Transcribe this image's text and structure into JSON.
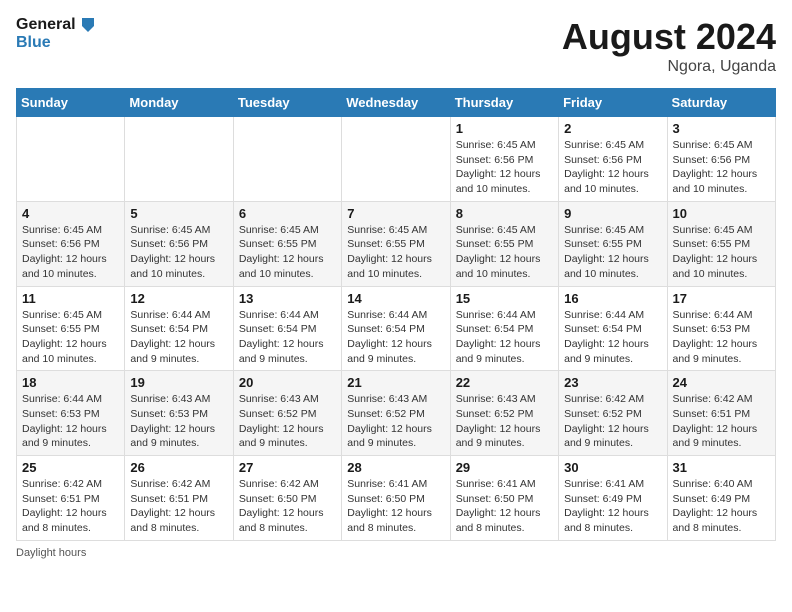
{
  "logo": {
    "line1": "General",
    "line2": "Blue"
  },
  "title": "August 2024",
  "location": "Ngora, Uganda",
  "days_of_week": [
    "Sunday",
    "Monday",
    "Tuesday",
    "Wednesday",
    "Thursday",
    "Friday",
    "Saturday"
  ],
  "footer": {
    "label": "Daylight hours"
  },
  "weeks": [
    [
      {
        "day": "",
        "sunrise": "",
        "sunset": "",
        "daylight": ""
      },
      {
        "day": "",
        "sunrise": "",
        "sunset": "",
        "daylight": ""
      },
      {
        "day": "",
        "sunrise": "",
        "sunset": "",
        "daylight": ""
      },
      {
        "day": "",
        "sunrise": "",
        "sunset": "",
        "daylight": ""
      },
      {
        "day": "1",
        "sunrise": "Sunrise: 6:45 AM",
        "sunset": "Sunset: 6:56 PM",
        "daylight": "Daylight: 12 hours and 10 minutes."
      },
      {
        "day": "2",
        "sunrise": "Sunrise: 6:45 AM",
        "sunset": "Sunset: 6:56 PM",
        "daylight": "Daylight: 12 hours and 10 minutes."
      },
      {
        "day": "3",
        "sunrise": "Sunrise: 6:45 AM",
        "sunset": "Sunset: 6:56 PM",
        "daylight": "Daylight: 12 hours and 10 minutes."
      }
    ],
    [
      {
        "day": "4",
        "sunrise": "Sunrise: 6:45 AM",
        "sunset": "Sunset: 6:56 PM",
        "daylight": "Daylight: 12 hours and 10 minutes."
      },
      {
        "day": "5",
        "sunrise": "Sunrise: 6:45 AM",
        "sunset": "Sunset: 6:56 PM",
        "daylight": "Daylight: 12 hours and 10 minutes."
      },
      {
        "day": "6",
        "sunrise": "Sunrise: 6:45 AM",
        "sunset": "Sunset: 6:55 PM",
        "daylight": "Daylight: 12 hours and 10 minutes."
      },
      {
        "day": "7",
        "sunrise": "Sunrise: 6:45 AM",
        "sunset": "Sunset: 6:55 PM",
        "daylight": "Daylight: 12 hours and 10 minutes."
      },
      {
        "day": "8",
        "sunrise": "Sunrise: 6:45 AM",
        "sunset": "Sunset: 6:55 PM",
        "daylight": "Daylight: 12 hours and 10 minutes."
      },
      {
        "day": "9",
        "sunrise": "Sunrise: 6:45 AM",
        "sunset": "Sunset: 6:55 PM",
        "daylight": "Daylight: 12 hours and 10 minutes."
      },
      {
        "day": "10",
        "sunrise": "Sunrise: 6:45 AM",
        "sunset": "Sunset: 6:55 PM",
        "daylight": "Daylight: 12 hours and 10 minutes."
      }
    ],
    [
      {
        "day": "11",
        "sunrise": "Sunrise: 6:45 AM",
        "sunset": "Sunset: 6:55 PM",
        "daylight": "Daylight: 12 hours and 10 minutes."
      },
      {
        "day": "12",
        "sunrise": "Sunrise: 6:44 AM",
        "sunset": "Sunset: 6:54 PM",
        "daylight": "Daylight: 12 hours and 9 minutes."
      },
      {
        "day": "13",
        "sunrise": "Sunrise: 6:44 AM",
        "sunset": "Sunset: 6:54 PM",
        "daylight": "Daylight: 12 hours and 9 minutes."
      },
      {
        "day": "14",
        "sunrise": "Sunrise: 6:44 AM",
        "sunset": "Sunset: 6:54 PM",
        "daylight": "Daylight: 12 hours and 9 minutes."
      },
      {
        "day": "15",
        "sunrise": "Sunrise: 6:44 AM",
        "sunset": "Sunset: 6:54 PM",
        "daylight": "Daylight: 12 hours and 9 minutes."
      },
      {
        "day": "16",
        "sunrise": "Sunrise: 6:44 AM",
        "sunset": "Sunset: 6:54 PM",
        "daylight": "Daylight: 12 hours and 9 minutes."
      },
      {
        "day": "17",
        "sunrise": "Sunrise: 6:44 AM",
        "sunset": "Sunset: 6:53 PM",
        "daylight": "Daylight: 12 hours and 9 minutes."
      }
    ],
    [
      {
        "day": "18",
        "sunrise": "Sunrise: 6:44 AM",
        "sunset": "Sunset: 6:53 PM",
        "daylight": "Daylight: 12 hours and 9 minutes."
      },
      {
        "day": "19",
        "sunrise": "Sunrise: 6:43 AM",
        "sunset": "Sunset: 6:53 PM",
        "daylight": "Daylight: 12 hours and 9 minutes."
      },
      {
        "day": "20",
        "sunrise": "Sunrise: 6:43 AM",
        "sunset": "Sunset: 6:52 PM",
        "daylight": "Daylight: 12 hours and 9 minutes."
      },
      {
        "day": "21",
        "sunrise": "Sunrise: 6:43 AM",
        "sunset": "Sunset: 6:52 PM",
        "daylight": "Daylight: 12 hours and 9 minutes."
      },
      {
        "day": "22",
        "sunrise": "Sunrise: 6:43 AM",
        "sunset": "Sunset: 6:52 PM",
        "daylight": "Daylight: 12 hours and 9 minutes."
      },
      {
        "day": "23",
        "sunrise": "Sunrise: 6:42 AM",
        "sunset": "Sunset: 6:52 PM",
        "daylight": "Daylight: 12 hours and 9 minutes."
      },
      {
        "day": "24",
        "sunrise": "Sunrise: 6:42 AM",
        "sunset": "Sunset: 6:51 PM",
        "daylight": "Daylight: 12 hours and 9 minutes."
      }
    ],
    [
      {
        "day": "25",
        "sunrise": "Sunrise: 6:42 AM",
        "sunset": "Sunset: 6:51 PM",
        "daylight": "Daylight: 12 hours and 8 minutes."
      },
      {
        "day": "26",
        "sunrise": "Sunrise: 6:42 AM",
        "sunset": "Sunset: 6:51 PM",
        "daylight": "Daylight: 12 hours and 8 minutes."
      },
      {
        "day": "27",
        "sunrise": "Sunrise: 6:42 AM",
        "sunset": "Sunset: 6:50 PM",
        "daylight": "Daylight: 12 hours and 8 minutes."
      },
      {
        "day": "28",
        "sunrise": "Sunrise: 6:41 AM",
        "sunset": "Sunset: 6:50 PM",
        "daylight": "Daylight: 12 hours and 8 minutes."
      },
      {
        "day": "29",
        "sunrise": "Sunrise: 6:41 AM",
        "sunset": "Sunset: 6:50 PM",
        "daylight": "Daylight: 12 hours and 8 minutes."
      },
      {
        "day": "30",
        "sunrise": "Sunrise: 6:41 AM",
        "sunset": "Sunset: 6:49 PM",
        "daylight": "Daylight: 12 hours and 8 minutes."
      },
      {
        "day": "31",
        "sunrise": "Sunrise: 6:40 AM",
        "sunset": "Sunset: 6:49 PM",
        "daylight": "Daylight: 12 hours and 8 minutes."
      }
    ]
  ]
}
